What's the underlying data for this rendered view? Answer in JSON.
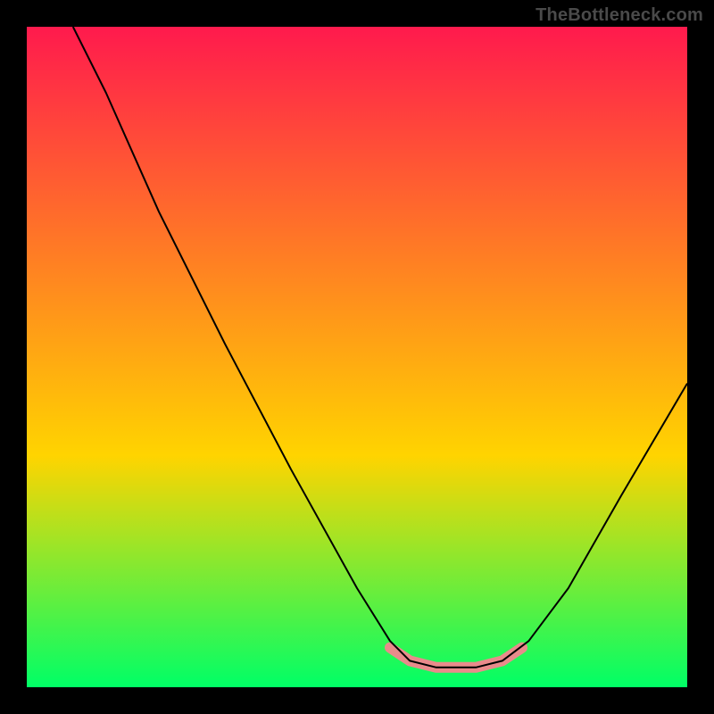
{
  "watermark": "TheBottleneck.com",
  "chart_data": {
    "type": "line",
    "title": "",
    "xlabel": "",
    "ylabel": "",
    "xlim": [
      0,
      100
    ],
    "ylim": [
      0,
      100
    ],
    "background_gradient": {
      "top": "#ff1a4d",
      "mid": "#ffd400",
      "bottom": "#00ff66"
    },
    "series": [
      {
        "name": "bottleneck-curve",
        "stroke": "#000000",
        "stroke_width": 2,
        "points": [
          {
            "x": 7,
            "y": 100
          },
          {
            "x": 12,
            "y": 90
          },
          {
            "x": 20,
            "y": 72
          },
          {
            "x": 30,
            "y": 52
          },
          {
            "x": 40,
            "y": 33
          },
          {
            "x": 50,
            "y": 15
          },
          {
            "x": 55,
            "y": 7
          },
          {
            "x": 58,
            "y": 4
          },
          {
            "x": 62,
            "y": 3
          },
          {
            "x": 68,
            "y": 3
          },
          {
            "x": 72,
            "y": 4
          },
          {
            "x": 76,
            "y": 7
          },
          {
            "x": 82,
            "y": 15
          },
          {
            "x": 90,
            "y": 29
          },
          {
            "x": 100,
            "y": 46
          }
        ]
      },
      {
        "name": "highlight-band",
        "stroke": "#e98b8b",
        "stroke_width": 12,
        "linecap": "round",
        "points": [
          {
            "x": 55,
            "y": 6
          },
          {
            "x": 58,
            "y": 4
          },
          {
            "x": 62,
            "y": 3
          },
          {
            "x": 68,
            "y": 3
          },
          {
            "x": 72,
            "y": 4
          },
          {
            "x": 75,
            "y": 6
          }
        ]
      }
    ]
  }
}
